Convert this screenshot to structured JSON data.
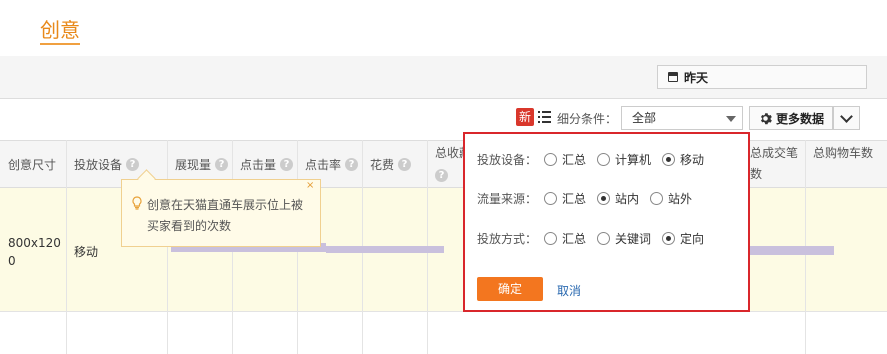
{
  "page": {
    "title": "创意"
  },
  "date_button": {
    "label": "昨天",
    "icon": "calendar-icon"
  },
  "toolbar": {
    "new_badge": "新",
    "filter_label": "细分条件：",
    "filter_value": "全部",
    "more_data_label": "更多数据"
  },
  "table": {
    "headers": [
      "创意尺寸",
      "投放设备",
      "展现量",
      "点击量",
      "点击率",
      "花费",
      "总收藏",
      "总成交笔数",
      "总购物车数"
    ],
    "row": {
      "size": "800x1200",
      "device": "移动"
    }
  },
  "tooltip": {
    "line1": "创意在天猫直通车展示位上被",
    "line2": "买家看到的次数",
    "close": "×"
  },
  "popup": {
    "device": {
      "label": "投放设备：",
      "options": [
        "汇总",
        "计算机",
        "移动"
      ],
      "selected": "移动"
    },
    "traffic": {
      "label": "流量来源：",
      "options": [
        "汇总",
        "站内",
        "站外"
      ],
      "selected": "站内"
    },
    "method": {
      "label": "投放方式：",
      "options": [
        "汇总",
        "关键词",
        "定向"
      ],
      "selected": "定向"
    },
    "confirm": "确定",
    "cancel": "取消"
  },
  "colors": {
    "accent": "#e8891a",
    "highlight_row": "#fdfbe4",
    "popup_border": "#d9262b",
    "confirm_button": "#f3761f",
    "link": "#2a69b0"
  }
}
